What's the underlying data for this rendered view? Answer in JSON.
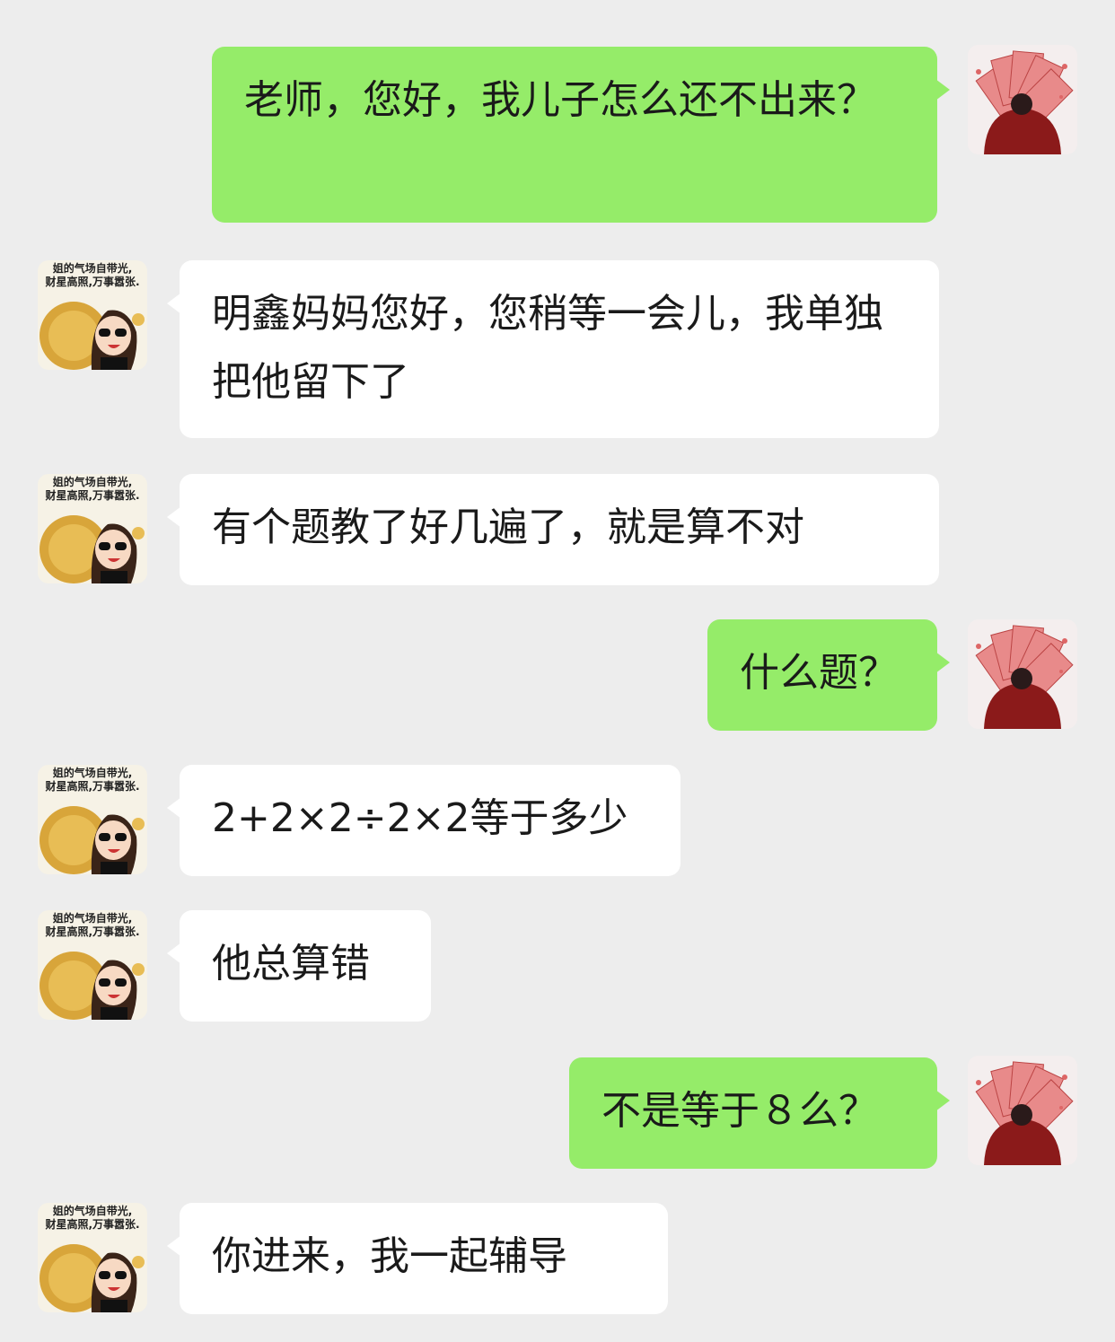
{
  "theme": {
    "background": "#ededed",
    "outgoing_bubble": "#95ec69",
    "incoming_bubble": "#ffffff"
  },
  "avatars": {
    "self": {
      "icon": "money-fan-avatar-icon"
    },
    "other": {
      "icon": "cartoon-girl-gold-coin-avatar-icon",
      "caption_line1": "姐的气场自带光,",
      "caption_line2": "财星高照,万事嚣张."
    }
  },
  "messages": [
    {
      "sender": "self",
      "text": "老师，您好，我儿子怎么还不出来？"
    },
    {
      "sender": "other",
      "text": "明鑫妈妈您好，您稍等一会儿，我单独把他留下了"
    },
    {
      "sender": "other",
      "text": "有个题教了好几遍了，就是算不对"
    },
    {
      "sender": "self",
      "text": "什么题？"
    },
    {
      "sender": "other",
      "text": "2+2×2÷2×2等于多少"
    },
    {
      "sender": "other",
      "text": "他总算错"
    },
    {
      "sender": "self",
      "text": "不是等于８么？"
    },
    {
      "sender": "other",
      "text": "你进来，我一起辅导"
    }
  ]
}
